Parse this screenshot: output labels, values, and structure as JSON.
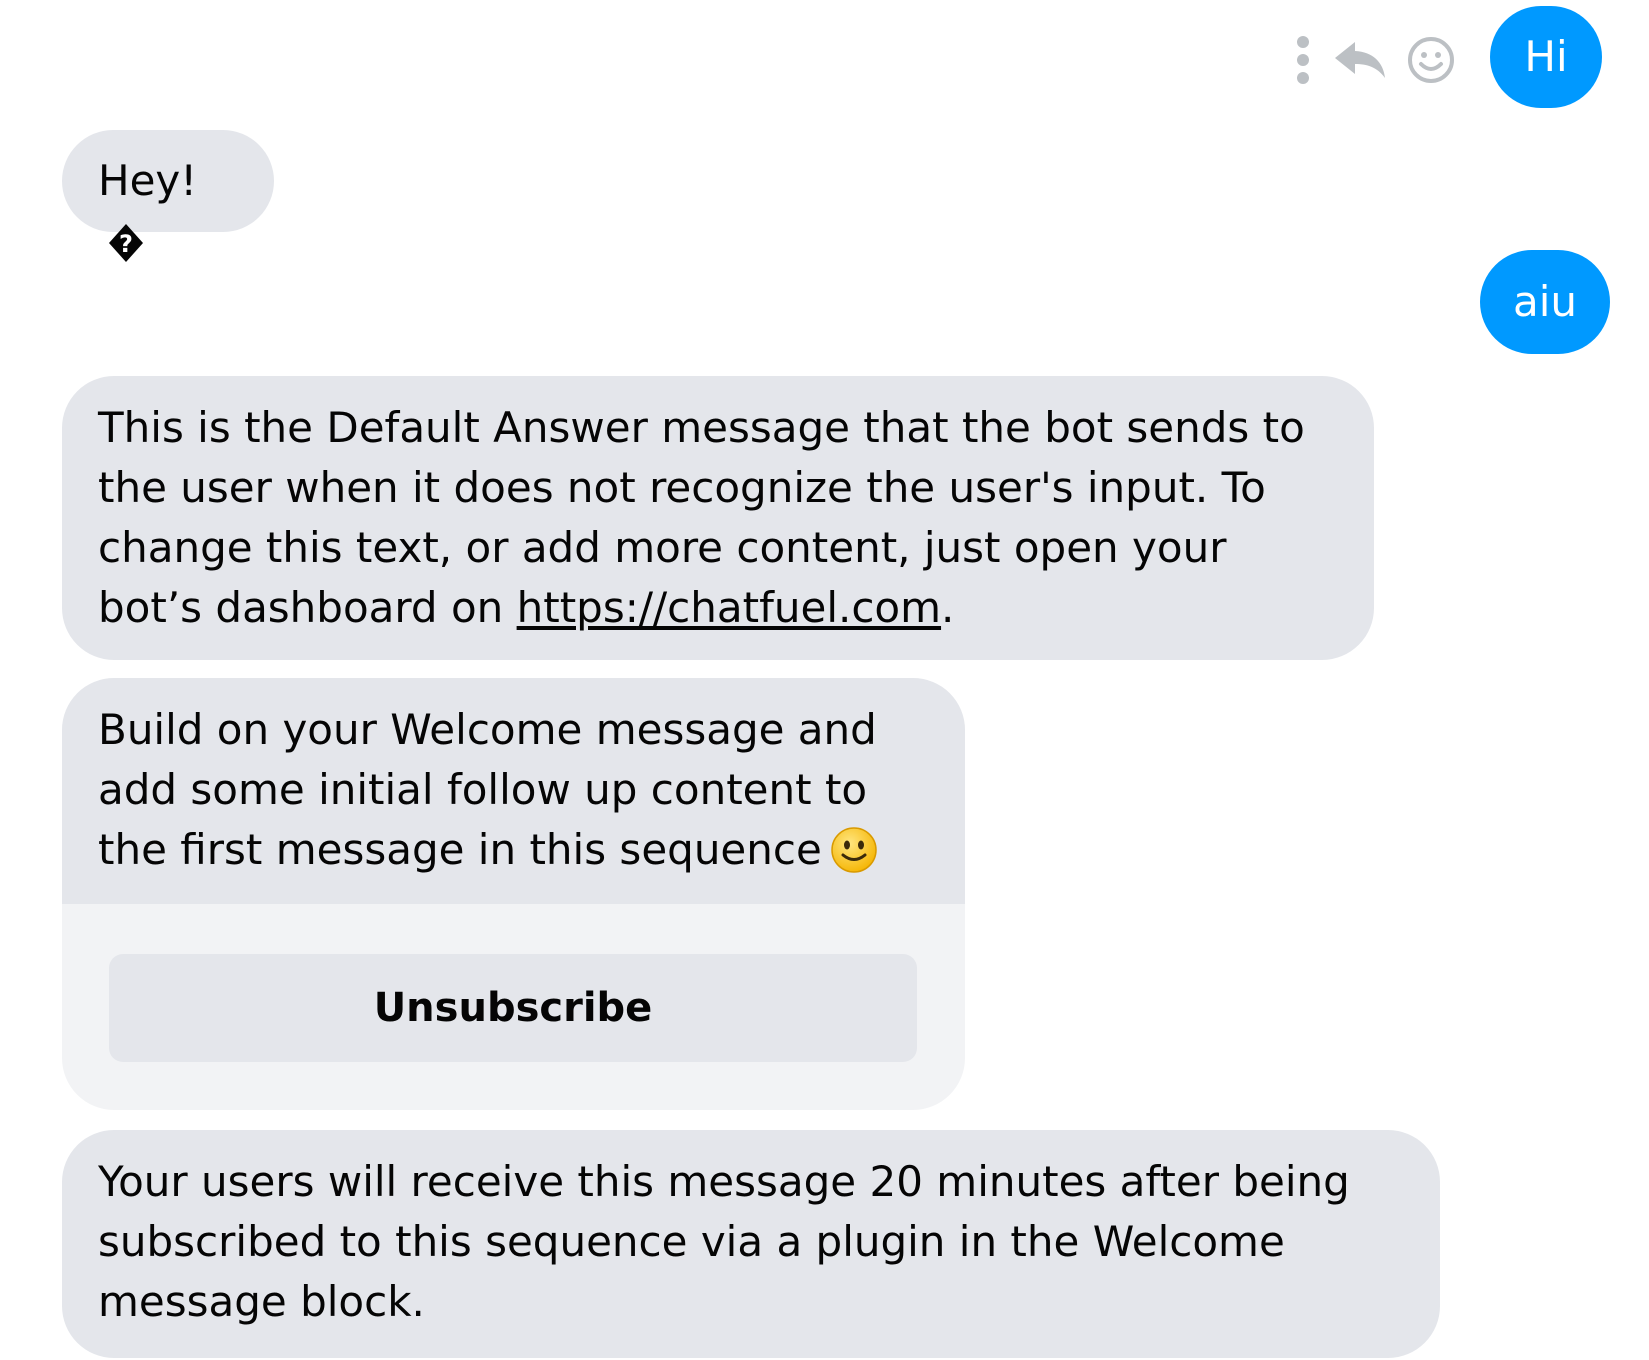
{
  "messages": {
    "out_1": {
      "text": "Hi"
    },
    "in_1": {
      "text": "Hey!",
      "glyph_icon": "question-diamond-icon"
    },
    "out_2": {
      "text": "aiu"
    },
    "in_2": {
      "text_before_link": "This is the Default Answer message that the bot sends to the user when it does not recognize the user's input.  To change this text, or add more content, just open your bot’s dashboard on ",
      "link_text": "https://chatfuel.com",
      "text_after_link": "."
    },
    "in_3": {
      "text": "Build on your Welcome message and add some initial follow up content to the first message in this sequence",
      "emoji_icon": "slightly-smiling-face-icon",
      "button_label": "Unsubscribe"
    },
    "in_4": {
      "text": "Your users will receive this message 20 minutes after being subscribed to this sequence via a plugin in the Welcome message block."
    }
  },
  "hover_actions": {
    "icons": [
      "more-vertical-icon",
      "reply-icon",
      "emoji-react-icon"
    ]
  },
  "colors": {
    "outgoing_bubble": "#0099ff",
    "incoming_bubble": "#e4e6eb",
    "card_footer": "#f2f3f5",
    "icon_gray": "#bcc0c4"
  }
}
